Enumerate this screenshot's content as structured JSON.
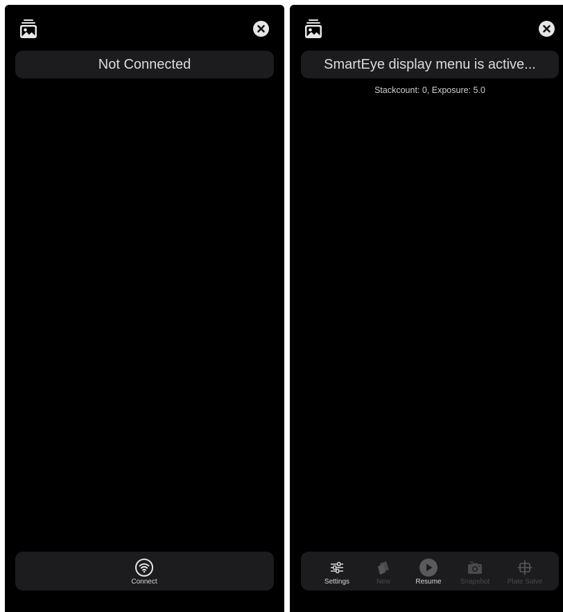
{
  "left_panel": {
    "status": "Not Connected",
    "connect_label": "Connect",
    "icons": {
      "gallery": "photo-stack-icon",
      "close": "close-icon",
      "connect": "wifi-icon"
    }
  },
  "right_panel": {
    "status": "SmartEye display menu is active...",
    "info": "Stackcount: 0, Exposure: 5.0",
    "toolbar": [
      {
        "label": "Settings",
        "icon": "sliders-icon",
        "enabled": true
      },
      {
        "label": "New",
        "icon": "new-stack-icon",
        "enabled": false
      },
      {
        "label": "Resume",
        "icon": "play-icon",
        "enabled": true
      },
      {
        "label": "Snapshot",
        "icon": "camera-icon",
        "enabled": false
      },
      {
        "label": "Plate Solve",
        "icon": "crosshair-icon",
        "enabled": false
      }
    ]
  },
  "colors": {
    "background": "#000000",
    "bar": "#1c1c1e",
    "text": "#dcdcdc",
    "disabled": "#4a4a4a"
  }
}
